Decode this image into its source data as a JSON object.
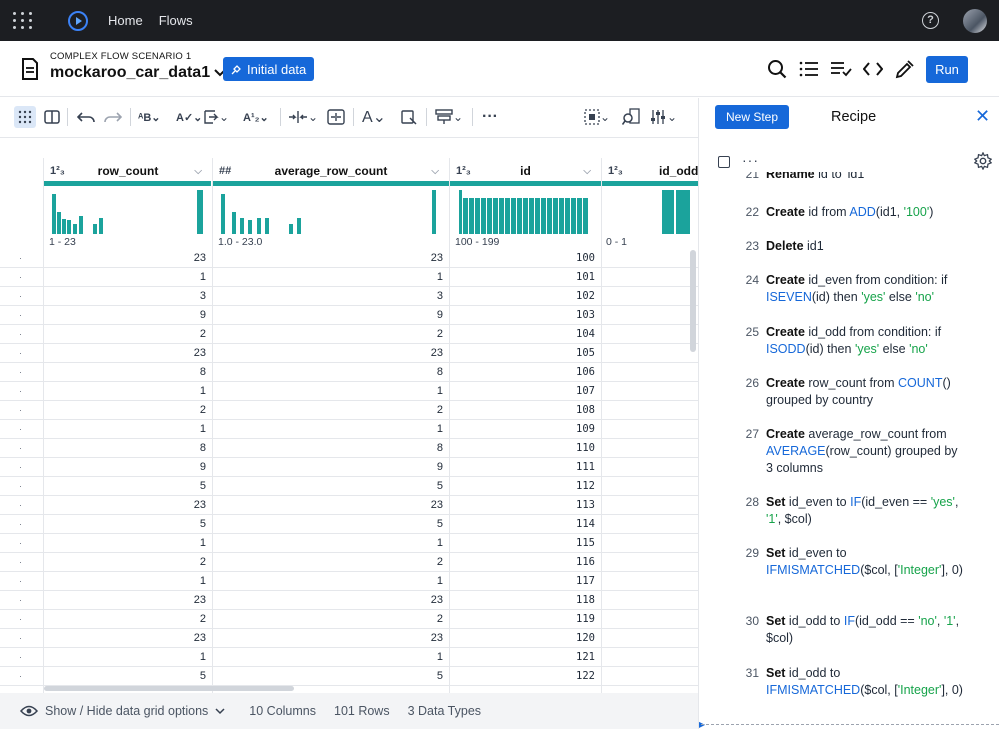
{
  "topbar": {
    "nav": [
      "Home",
      "Flows"
    ],
    "help_label": "?"
  },
  "header": {
    "scenario": "COMPLEX FLOW SCENARIO 1",
    "dataset_title": "mockaroo_car_data1",
    "initial_data_label": "Initial data",
    "run_label": "Run"
  },
  "columns": [
    {
      "type": "1²₃",
      "name": "row_count",
      "range": "1 - 23"
    },
    {
      "type": "##",
      "name": "average_row_count",
      "range": "1.0 - 23.0"
    },
    {
      "type": "1²₃",
      "name": "id",
      "range": "100 - 199"
    },
    {
      "type": "1²₃",
      "name": "id_odd",
      "range": "0 - 1"
    }
  ],
  "rows": [
    [
      "23",
      "23",
      "100"
    ],
    [
      "1",
      "1",
      "101"
    ],
    [
      "3",
      "3",
      "102"
    ],
    [
      "9",
      "9",
      "103"
    ],
    [
      "2",
      "2",
      "104"
    ],
    [
      "23",
      "23",
      "105"
    ],
    [
      "8",
      "8",
      "106"
    ],
    [
      "1",
      "1",
      "107"
    ],
    [
      "2",
      "2",
      "108"
    ],
    [
      "1",
      "1",
      "109"
    ],
    [
      "8",
      "8",
      "110"
    ],
    [
      "9",
      "9",
      "111"
    ],
    [
      "5",
      "5",
      "112"
    ],
    [
      "23",
      "23",
      "113"
    ],
    [
      "5",
      "5",
      "114"
    ],
    [
      "1",
      "1",
      "115"
    ],
    [
      "2",
      "2",
      "116"
    ],
    [
      "1",
      "1",
      "117"
    ],
    [
      "23",
      "23",
      "118"
    ],
    [
      "2",
      "2",
      "119"
    ],
    [
      "23",
      "23",
      "120"
    ],
    [
      "1",
      "1",
      "121"
    ],
    [
      "5",
      "5",
      "122"
    ]
  ],
  "footer": {
    "options_label": "Show / Hide data grid options",
    "columns_count": "10 Columns",
    "rows_count": "101 Rows",
    "types_count": "3 Data Types"
  },
  "recipe": {
    "new_step_label": "New Step",
    "title": "Recipe",
    "steps": [
      {
        "num": "21",
        "html": "<span class='kw'>Rename</span> id to 'id1'"
      },
      {
        "num": "22",
        "html": "<span class='kw'>Create</span> id from <span class='fn'>ADD</span>(id1, <span class='str'>'100'</span>)"
      },
      {
        "num": "23",
        "html": "<span class='kw'>Delete</span> id1"
      },
      {
        "num": "24",
        "html": "<span class='kw'>Create</span> id_even from condition: if <span class='fn'>ISEVEN</span>(id) then <span class='str'>'yes'</span> else <span class='str'>'no'</span>"
      },
      {
        "num": "25",
        "html": "<span class='kw'>Create</span> id_odd from condition: if <span class='fn'>ISODD</span>(id) then <span class='str'>'yes'</span> else <span class='str'>'no'</span>"
      },
      {
        "num": "26",
        "html": "<span class='kw'>Create</span> row_count from <span class='fn'>COUNT</span>() grouped by country"
      },
      {
        "num": "27",
        "html": "<span class='kw'>Create</span> average_row_count from <span class='fn'>AVERAGE</span>(row_count) grouped by 3 columns"
      },
      {
        "num": "28",
        "html": "<span class='kw'>Set</span> id_even to <span class='fn'>IF</span>(id_even == <span class='str'>'yes'</span>, <span class='str'>'1'</span>, $col)"
      },
      {
        "num": "29",
        "html": "<span class='kw'>Set</span> id_even to <span class='fn'>IFMISMATCHED</span>($col, [<span class='str'>'Integer'</span>], 0)"
      },
      {
        "num": "30",
        "html": "<span class='kw'>Set</span> id_odd to <span class='fn'>IF</span>(id_odd == <span class='str'>'no'</span>, <span class='str'>'1'</span>, $col)"
      },
      {
        "num": "31",
        "html": "<span class='kw'>Set</span> id_odd to <span class='fn'>IFMISMATCHED</span>($col, [<span class='str'>'Integer'</span>], 0)"
      }
    ]
  },
  "colors": {
    "accent": "#1668d9",
    "histogram": "#1ba39c",
    "topbar": "#1c1e22"
  }
}
